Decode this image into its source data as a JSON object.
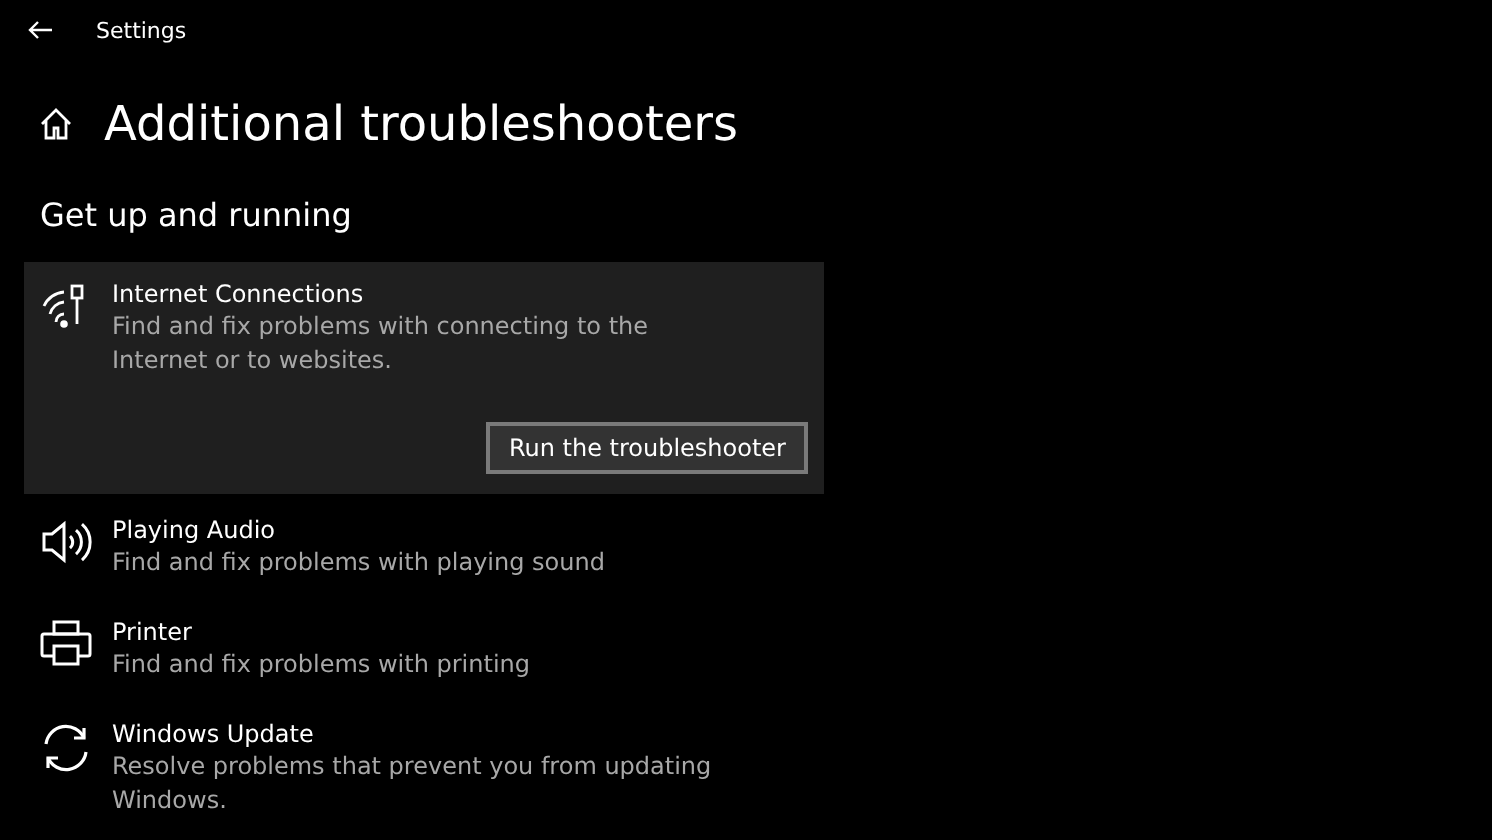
{
  "window": {
    "title": "Settings"
  },
  "page": {
    "title": "Additional troubleshooters"
  },
  "section": {
    "title": "Get up and running"
  },
  "items": [
    {
      "kind": "internet",
      "name": "Internet Connections",
      "description": "Find and fix problems with connecting to the Internet or to websites.",
      "expanded": true,
      "button": "Run the troubleshooter"
    },
    {
      "kind": "audio",
      "name": "Playing Audio",
      "description": "Find and fix problems with playing sound",
      "expanded": false
    },
    {
      "kind": "printer",
      "name": "Printer",
      "description": "Find and fix problems with printing",
      "expanded": false
    },
    {
      "kind": "update",
      "name": "Windows Update",
      "description": "Resolve problems that prevent you from updating Windows.",
      "expanded": false
    }
  ]
}
